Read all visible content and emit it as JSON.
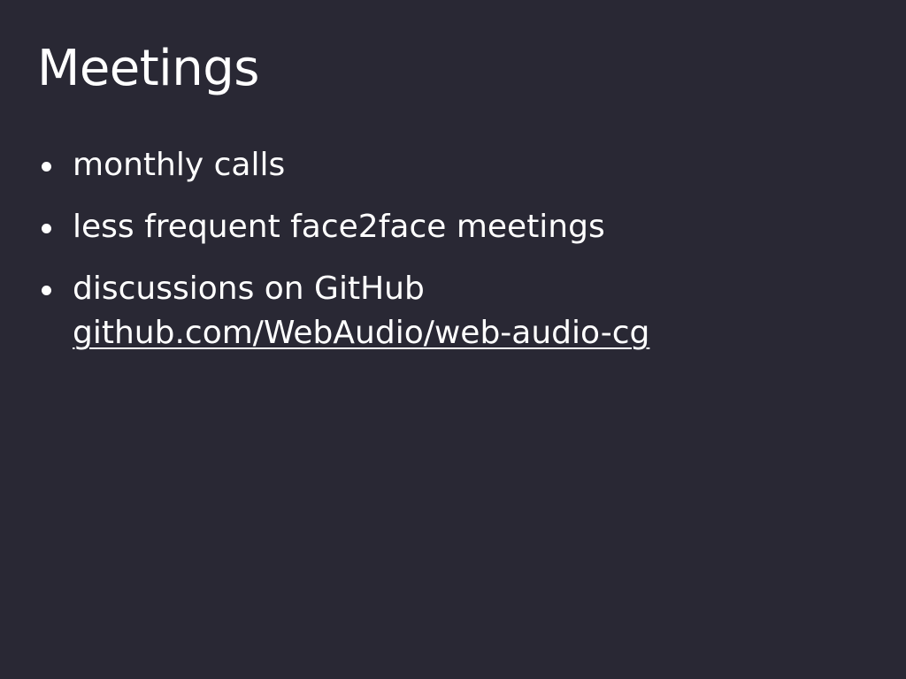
{
  "slide": {
    "title": "Meetings",
    "bullets": [
      {
        "text": "monthly calls"
      },
      {
        "text": "less frequent face2face meetings"
      },
      {
        "text": "discussions on GitHub",
        "link": "github.com/WebAudio/web-audio-cg"
      }
    ]
  },
  "colors": {
    "background": "#292834",
    "text": "#ffffff"
  }
}
